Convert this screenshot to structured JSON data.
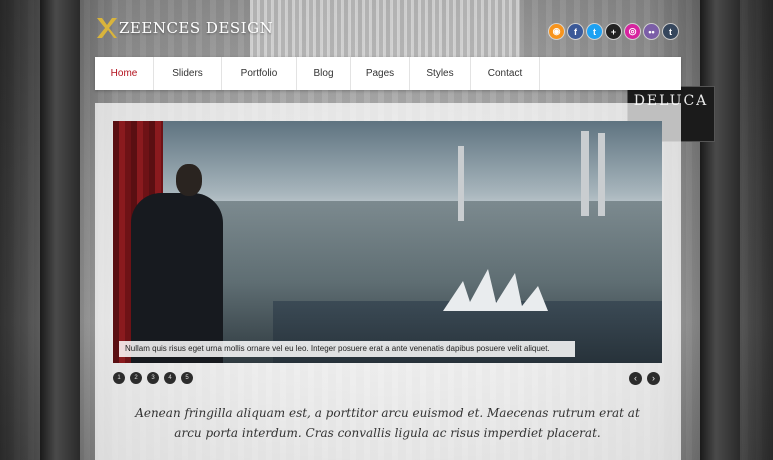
{
  "brand": {
    "logo_text": "ZEENCES DESIGN",
    "accent": "#d9b43b",
    "active_color": "#b3111d"
  },
  "social_icons": [
    {
      "name": "rss-icon",
      "glyph": "◉",
      "color": "#f7941d"
    },
    {
      "name": "facebook-icon",
      "glyph": "f",
      "color": "#3b5998"
    },
    {
      "name": "twitter-icon",
      "glyph": "t",
      "color": "#1da1f2"
    },
    {
      "name": "google-plus-icon",
      "glyph": "+",
      "color": "#222222"
    },
    {
      "name": "instagram-icon",
      "glyph": "◎",
      "color": "#d6249f"
    },
    {
      "name": "flickr-icon",
      "glyph": "••",
      "color": "#7b5ea7"
    },
    {
      "name": "tumblr-icon",
      "glyph": "t",
      "color": "#35465c"
    }
  ],
  "nav": {
    "items": [
      {
        "label": "Home",
        "active": true
      },
      {
        "label": "Sliders"
      },
      {
        "label": "Portfolio"
      },
      {
        "label": "Blog"
      },
      {
        "label": "Pages"
      },
      {
        "label": "Styles"
      },
      {
        "label": "Contact"
      }
    ]
  },
  "background": {
    "sign_text": "DELUCA"
  },
  "slider": {
    "caption": "Nullam quis risus eget urna mollis ornare vel eu leo. Integer posuere erat a ante venenatis dapibus posuere velit aliquet.",
    "pager": [
      "1",
      "2",
      "3",
      "4",
      "5"
    ],
    "prev_label": "‹",
    "next_label": "›"
  },
  "tagline": "Aenean fringilla aliquam est, a porttitor arcu euismod et. Maecenas rutrum erat at arcu porta interdum. Cras convallis ligula ac risus imperdiet placerat."
}
